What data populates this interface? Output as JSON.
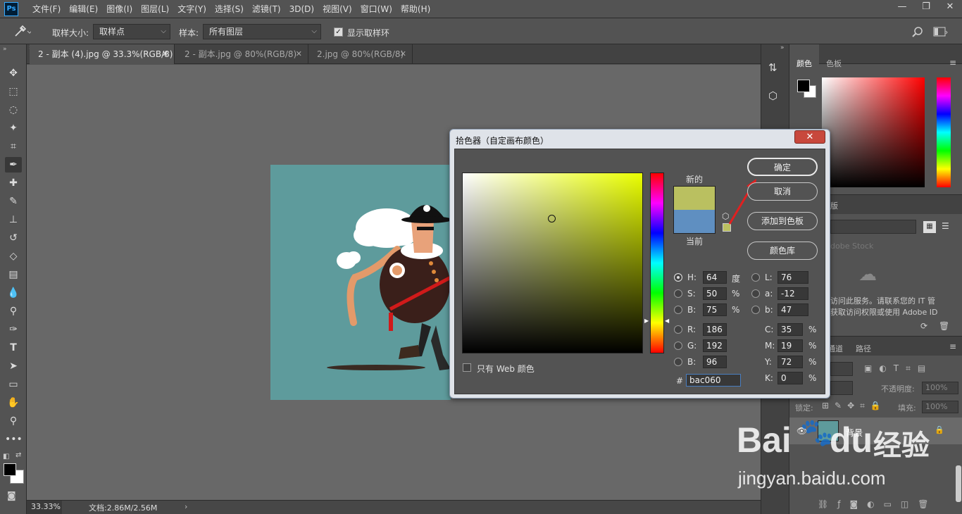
{
  "app": {
    "logo": "Ps"
  },
  "menu": [
    "文件(F)",
    "编辑(E)",
    "图像(I)",
    "图层(L)",
    "文字(Y)",
    "选择(S)",
    "滤镜(T)",
    "3D(D)",
    "视图(V)",
    "窗口(W)",
    "帮助(H)"
  ],
  "window_controls": {
    "minimize": "—",
    "restore": "❐",
    "close": "✕"
  },
  "options": {
    "sample_size_label": "取样大小:",
    "sample_size_value": "取样点",
    "sample_label": "样本:",
    "sample_value": "所有图层",
    "show_ring_label": "显示取样环",
    "show_ring_checked": true
  },
  "tabs": [
    {
      "label": "2 - 副本 (4).jpg @ 33.3%(RGB/8)",
      "active": true
    },
    {
      "label": "2 - 副本.jpg @ 80%(RGB/8)",
      "active": false
    },
    {
      "label": "2.jpg @ 80%(RGB/8)",
      "active": false
    }
  ],
  "status": {
    "zoom": "33.33%",
    "doc": "文档:2.86M/2.56M"
  },
  "panels": {
    "color_tab": "颜色",
    "swatches_tab": "色板",
    "library_fragment": "版",
    "stock_placeholder": "dobe Stock",
    "cc_message_line1": "访问此服务。请联系您的 IT 管",
    "cc_message_line2": "获取访问权限或使用 Adobe ID",
    "channels_tab": "通道",
    "paths_tab": "路径",
    "opacity_label": "不透明度:",
    "opacity_value": "100%",
    "lock_label": "锁定:",
    "fill_label": "填充:",
    "fill_value": "100%",
    "layer_name": "背景"
  },
  "dialog": {
    "title": "拾色器（自定画布颜色）",
    "close": "✕",
    "new_label": "新的",
    "current_label": "当前",
    "new_color": "#bac060",
    "current_color": "#5f8fc1",
    "buttons": {
      "ok": "确定",
      "cancel": "取消",
      "add_swatch": "添加到色板",
      "color_library": "颜色库"
    },
    "web_only_label": "只有 Web 颜色",
    "web_only_checked": false,
    "hsb": {
      "H": "64",
      "S": "50",
      "B": "75",
      "H_unit": "度",
      "S_unit": "%",
      "B_unit": "%"
    },
    "rgb": {
      "R": "186",
      "G": "192",
      "B": "96"
    },
    "lab": {
      "L": "76",
      "a": "-12",
      "b": "47"
    },
    "cmyk": {
      "C": "35",
      "M": "19",
      "Y": "72",
      "K": "0",
      "unit": "%"
    },
    "hex_label": "#",
    "hex": "bac060",
    "selected_mode": "H",
    "hue_color": "#eaff00"
  },
  "watermark": {
    "brand": "Bai",
    "brand2": "du",
    "cn": "经验",
    "url": "jingyan.baidu.com"
  }
}
